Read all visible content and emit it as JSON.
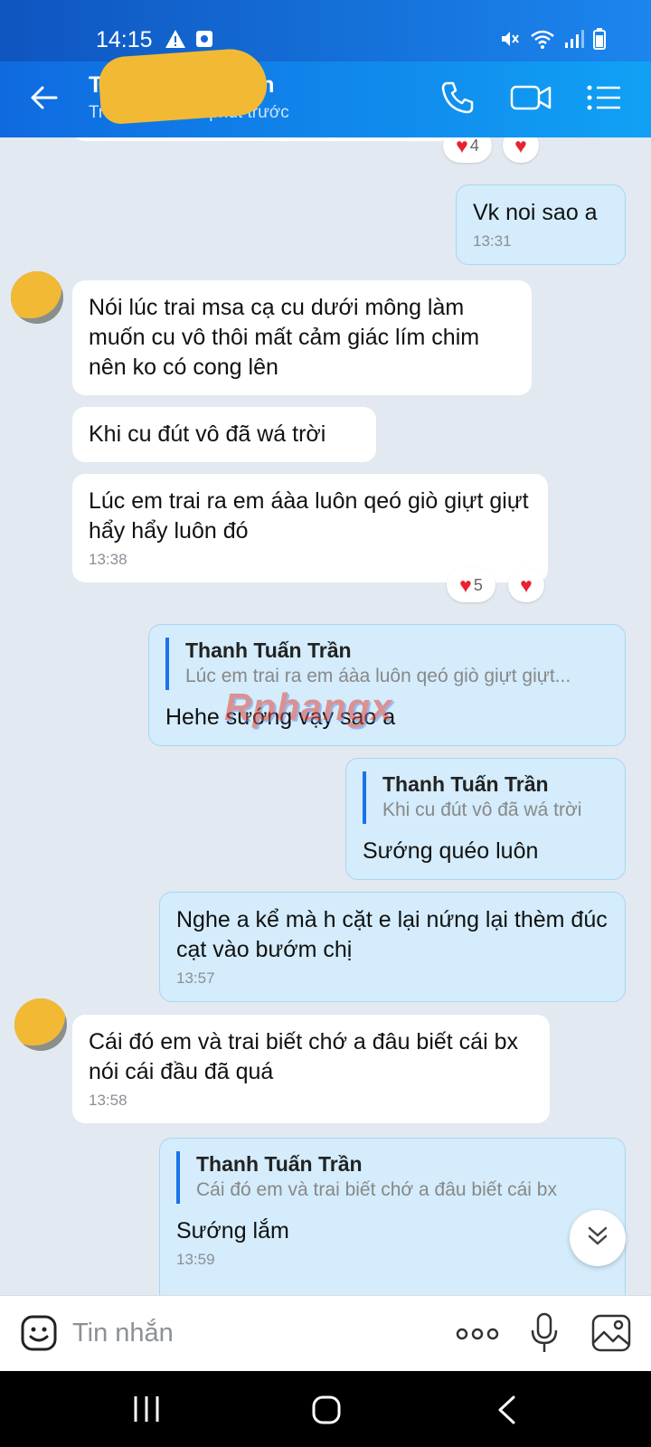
{
  "status_bar": {
    "time": "14:15"
  },
  "header": {
    "name": "T",
    "name_suffix": "n",
    "status": "Truy cập",
    "status_suffix": "phút trước"
  },
  "messages": [
    {
      "id": 1,
      "text": "Vk noi sao a",
      "time": "13:31"
    },
    {
      "id": 2,
      "text": "Nói lúc trai msa cạ cu dưới mông làm muốn cu vô thôi mất cảm giác lím chim nên ko có cong lên"
    },
    {
      "id": 3,
      "text": "Khi cu đút vô đã wá trời"
    },
    {
      "id": 4,
      "text": "Lúc em trai ra em áàa luôn qeó giò giựt giựt hẩy hẩy luôn đó",
      "time": "13:38"
    },
    {
      "id": 5,
      "reply_name": "Thanh Tuấn Trần",
      "reply_text": "Lúc em trai ra em áàa luôn qeó giò giựt giựt...",
      "text": "Hehe sướng vạy sao a"
    },
    {
      "id": 6,
      "reply_name": "Thanh Tuấn Trần",
      "reply_text": "Khi cu đút vô đã wá trời",
      "text": "Sướng quéo luôn"
    },
    {
      "id": 7,
      "text": "Nghe a kể mà h cặt e lại nứng lại thèm đúc cạt vào bướm chị",
      "time": "13:57"
    },
    {
      "id": 8,
      "text": "Cái đó em và trai biết chớ a đâu biết cái bx nói cái đầu đã quá",
      "time": "13:58"
    },
    {
      "id": 9,
      "reply_name": "Thanh Tuấn Trần",
      "reply_text": "Cái đó em và trai biết chớ a đâu biết cái bx",
      "text": "Sướng lắm",
      "time": "13:59"
    }
  ],
  "reactions": {
    "top_count": "4",
    "mid_count": "5"
  },
  "watermark": "Rphangx",
  "input": {
    "placeholder": "Tin nhắn"
  },
  "colors": {
    "header_start": "#0f6ae0",
    "header_end": "#10a1f5",
    "outgoing_bubble": "#d4ecfb",
    "incoming_bubble": "#ffffff",
    "chat_background": "#e2e9f1",
    "heart": "#e8232f",
    "quote_bar": "#1a73e8"
  },
  "icons": [
    "back-arrow-icon",
    "phone-icon",
    "video-call-icon",
    "menu-list-icon",
    "warning-icon",
    "mute-icon",
    "wifi-icon",
    "signal-icon",
    "battery-icon",
    "sticker-icon",
    "more-icon",
    "microphone-icon",
    "image-icon",
    "chevron-down-icon",
    "recent-apps-icon",
    "home-icon",
    "nav-back-icon"
  ]
}
